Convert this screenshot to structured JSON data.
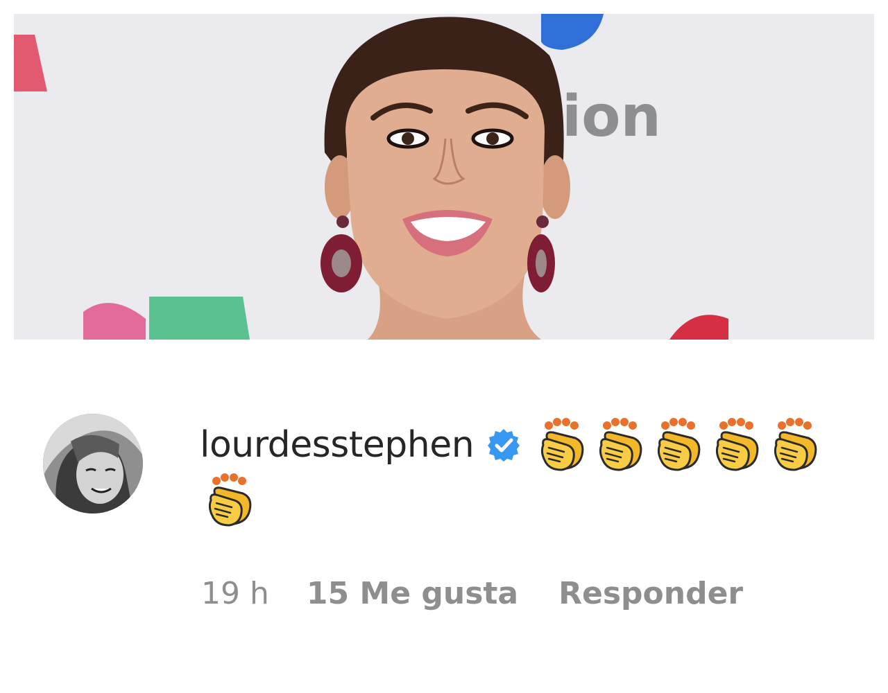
{
  "post": {
    "photo_icon": "portrait-photo",
    "backdrop_text": "ion"
  },
  "comment": {
    "avatar_icon": "user-avatar",
    "username": "lourdesstephen",
    "verified_icon": "verified-badge-icon",
    "verified_color": "#3897f0",
    "emoji": [
      "👏",
      "👏",
      "👏",
      "👏",
      "👏",
      "👏"
    ],
    "time": "19 h",
    "likes": "15 Me gusta",
    "reply": "Responder"
  },
  "colors": {
    "username": "#262626",
    "meta": "#8e8e8e",
    "clap_yellow": "#f7c438",
    "clap_orange": "#e8712c"
  }
}
